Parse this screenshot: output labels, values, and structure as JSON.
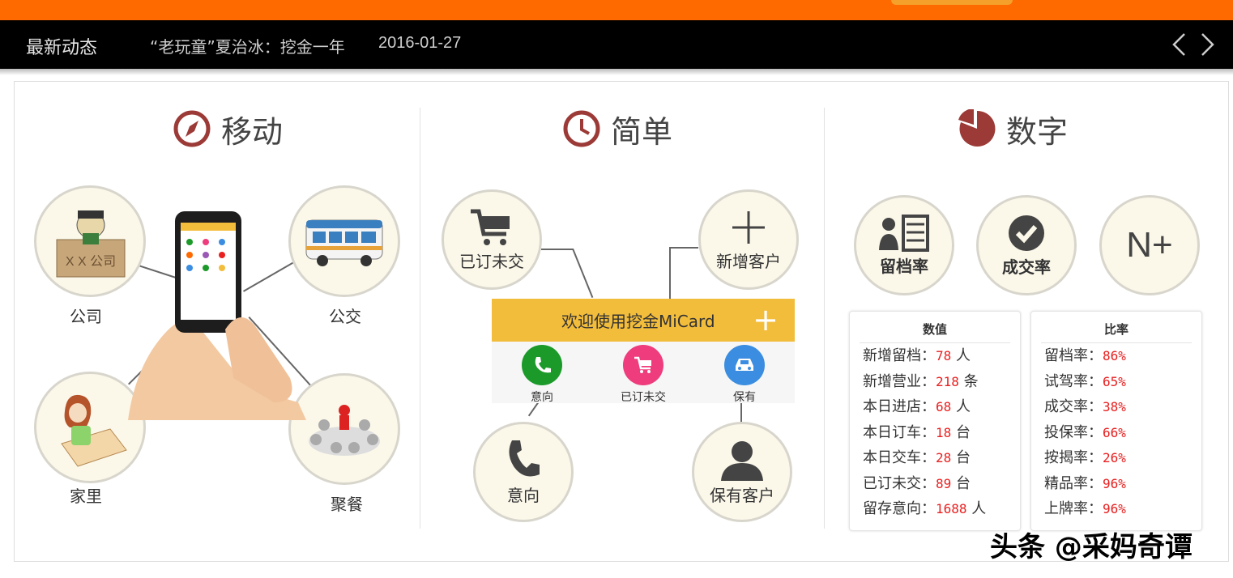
{
  "news": {
    "label": "最新动态",
    "title": "“老玩童”夏治冰：挖金一年",
    "date": "2016-01-27"
  },
  "sections": {
    "mobile": {
      "title": "移动",
      "items": [
        "公司",
        "公交",
        "家里",
        "聚餐"
      ],
      "company_sign": "X X 公司"
    },
    "simple": {
      "title": "简单",
      "items": [
        "已订未交",
        "新增客户",
        "意向",
        "保有客户"
      ],
      "welcome": "欢迎使用挖金MiCard",
      "menu": [
        "意向",
        "已订未交",
        "保有"
      ]
    },
    "numbers": {
      "title": "数字",
      "badges": [
        "留档率",
        "成交率",
        "N+"
      ],
      "values_header": "数值",
      "values": [
        {
          "label": "新增留档：",
          "value": "78",
          "unit": "人"
        },
        {
          "label": "新增营业：",
          "value": "218",
          "unit": "条"
        },
        {
          "label": "本日进店：",
          "value": "68",
          "unit": "人"
        },
        {
          "label": "本日订车：",
          "value": "18",
          "unit": "台"
        },
        {
          "label": "本日交车：",
          "value": "28",
          "unit": "台"
        },
        {
          "label": "已订未交：",
          "value": "89",
          "unit": "台"
        },
        {
          "label": "留存意向：",
          "value": "1688",
          "unit": "人"
        }
      ],
      "rates_header": "比率",
      "rates": [
        {
          "label": "留档率：",
          "value": "86%"
        },
        {
          "label": "试驾率：",
          "value": "65%"
        },
        {
          "label": "成交率：",
          "value": "38%"
        },
        {
          "label": "投保率：",
          "value": "66%"
        },
        {
          "label": "按揭率：",
          "value": "26%"
        },
        {
          "label": "精品率：",
          "value": "96%"
        },
        {
          "label": "上牌率：",
          "value": "96%"
        }
      ]
    }
  },
  "watermark": "头条 @采妈奇谭",
  "colors": {
    "brand_orange": "#ff6a00",
    "icon_red": "#9b3a36",
    "welcome_yellow": "#f3bd3c",
    "value_red": "#e82020",
    "green": "#1b9a2a",
    "pink": "#ee3c7c",
    "blue": "#3a8de0"
  }
}
